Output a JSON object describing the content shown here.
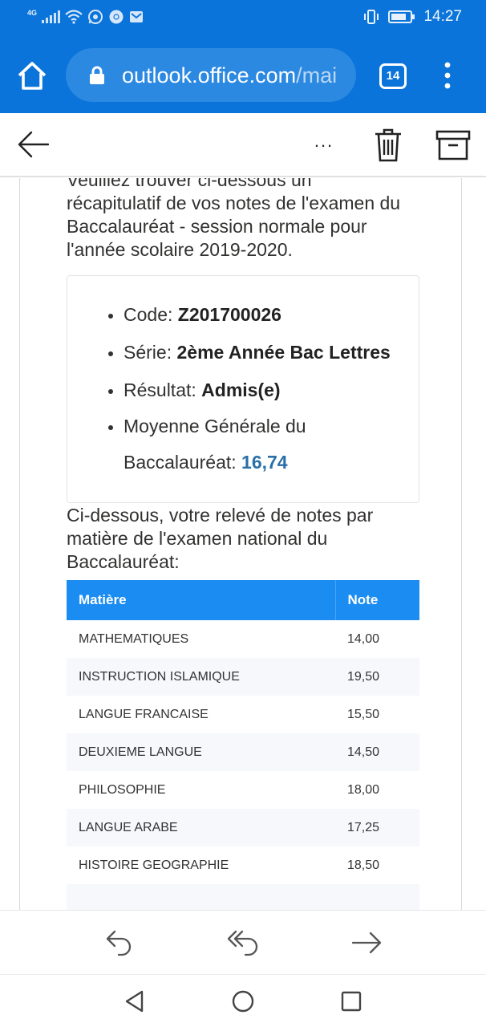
{
  "status_bar": {
    "network": "4G",
    "time": "14:27"
  },
  "browser": {
    "url_primary": "outlook.office.com",
    "url_rest": "/mai",
    "tab_count": "14"
  },
  "toolbar": {
    "more_label": "..."
  },
  "email": {
    "intro_partial": "Veuillez trouver ci-dessous un",
    "intro_rest": "récapitulatif de vos notes de l'examen du Baccalauréat - session normale pour l'année scolaire 2019-2020.",
    "summary": {
      "code_label": "Code: ",
      "code_value": "Z201700026",
      "serie_label": "Série: ",
      "serie_value": "2ème Année Bac Lettres",
      "resultat_label": "Résultat: ",
      "resultat_value": "Admis(e)",
      "moyenne_label_1": "Moyenne Générale du",
      "moyenne_label_2": "Baccalauréat: ",
      "moyenne_value": "16,74"
    },
    "section_title": "Ci-dessous, votre relevé de notes par matière de l'examen national du Baccalauréat:",
    "table": {
      "headers": [
        "Matière",
        "Note"
      ],
      "rows": [
        [
          "MATHEMATIQUES",
          "14,00"
        ],
        [
          "INSTRUCTION ISLAMIQUE",
          "19,50"
        ],
        [
          "LANGUE FRANCAISE",
          "15,50"
        ],
        [
          "DEUXIEME LANGUE",
          "14,50"
        ],
        [
          "PHILOSOPHIE",
          "18,00"
        ],
        [
          "LANGUE ARABE",
          "17,25"
        ],
        [
          "HISTOIRE GEOGRAPHIE",
          "18,50"
        ]
      ]
    }
  },
  "colors": {
    "brand_blue": "#0a74da",
    "table_header": "#1a8cf2",
    "average_value": "#2a6fa8"
  },
  "icons": {
    "home": "home-icon",
    "lock": "lock-icon",
    "menu": "more-vertical-icon",
    "back": "arrow-left-icon",
    "trash": "trash-icon",
    "archive": "archive-icon",
    "reply": "reply-icon",
    "reply_all": "reply-all-icon",
    "forward": "forward-icon"
  }
}
